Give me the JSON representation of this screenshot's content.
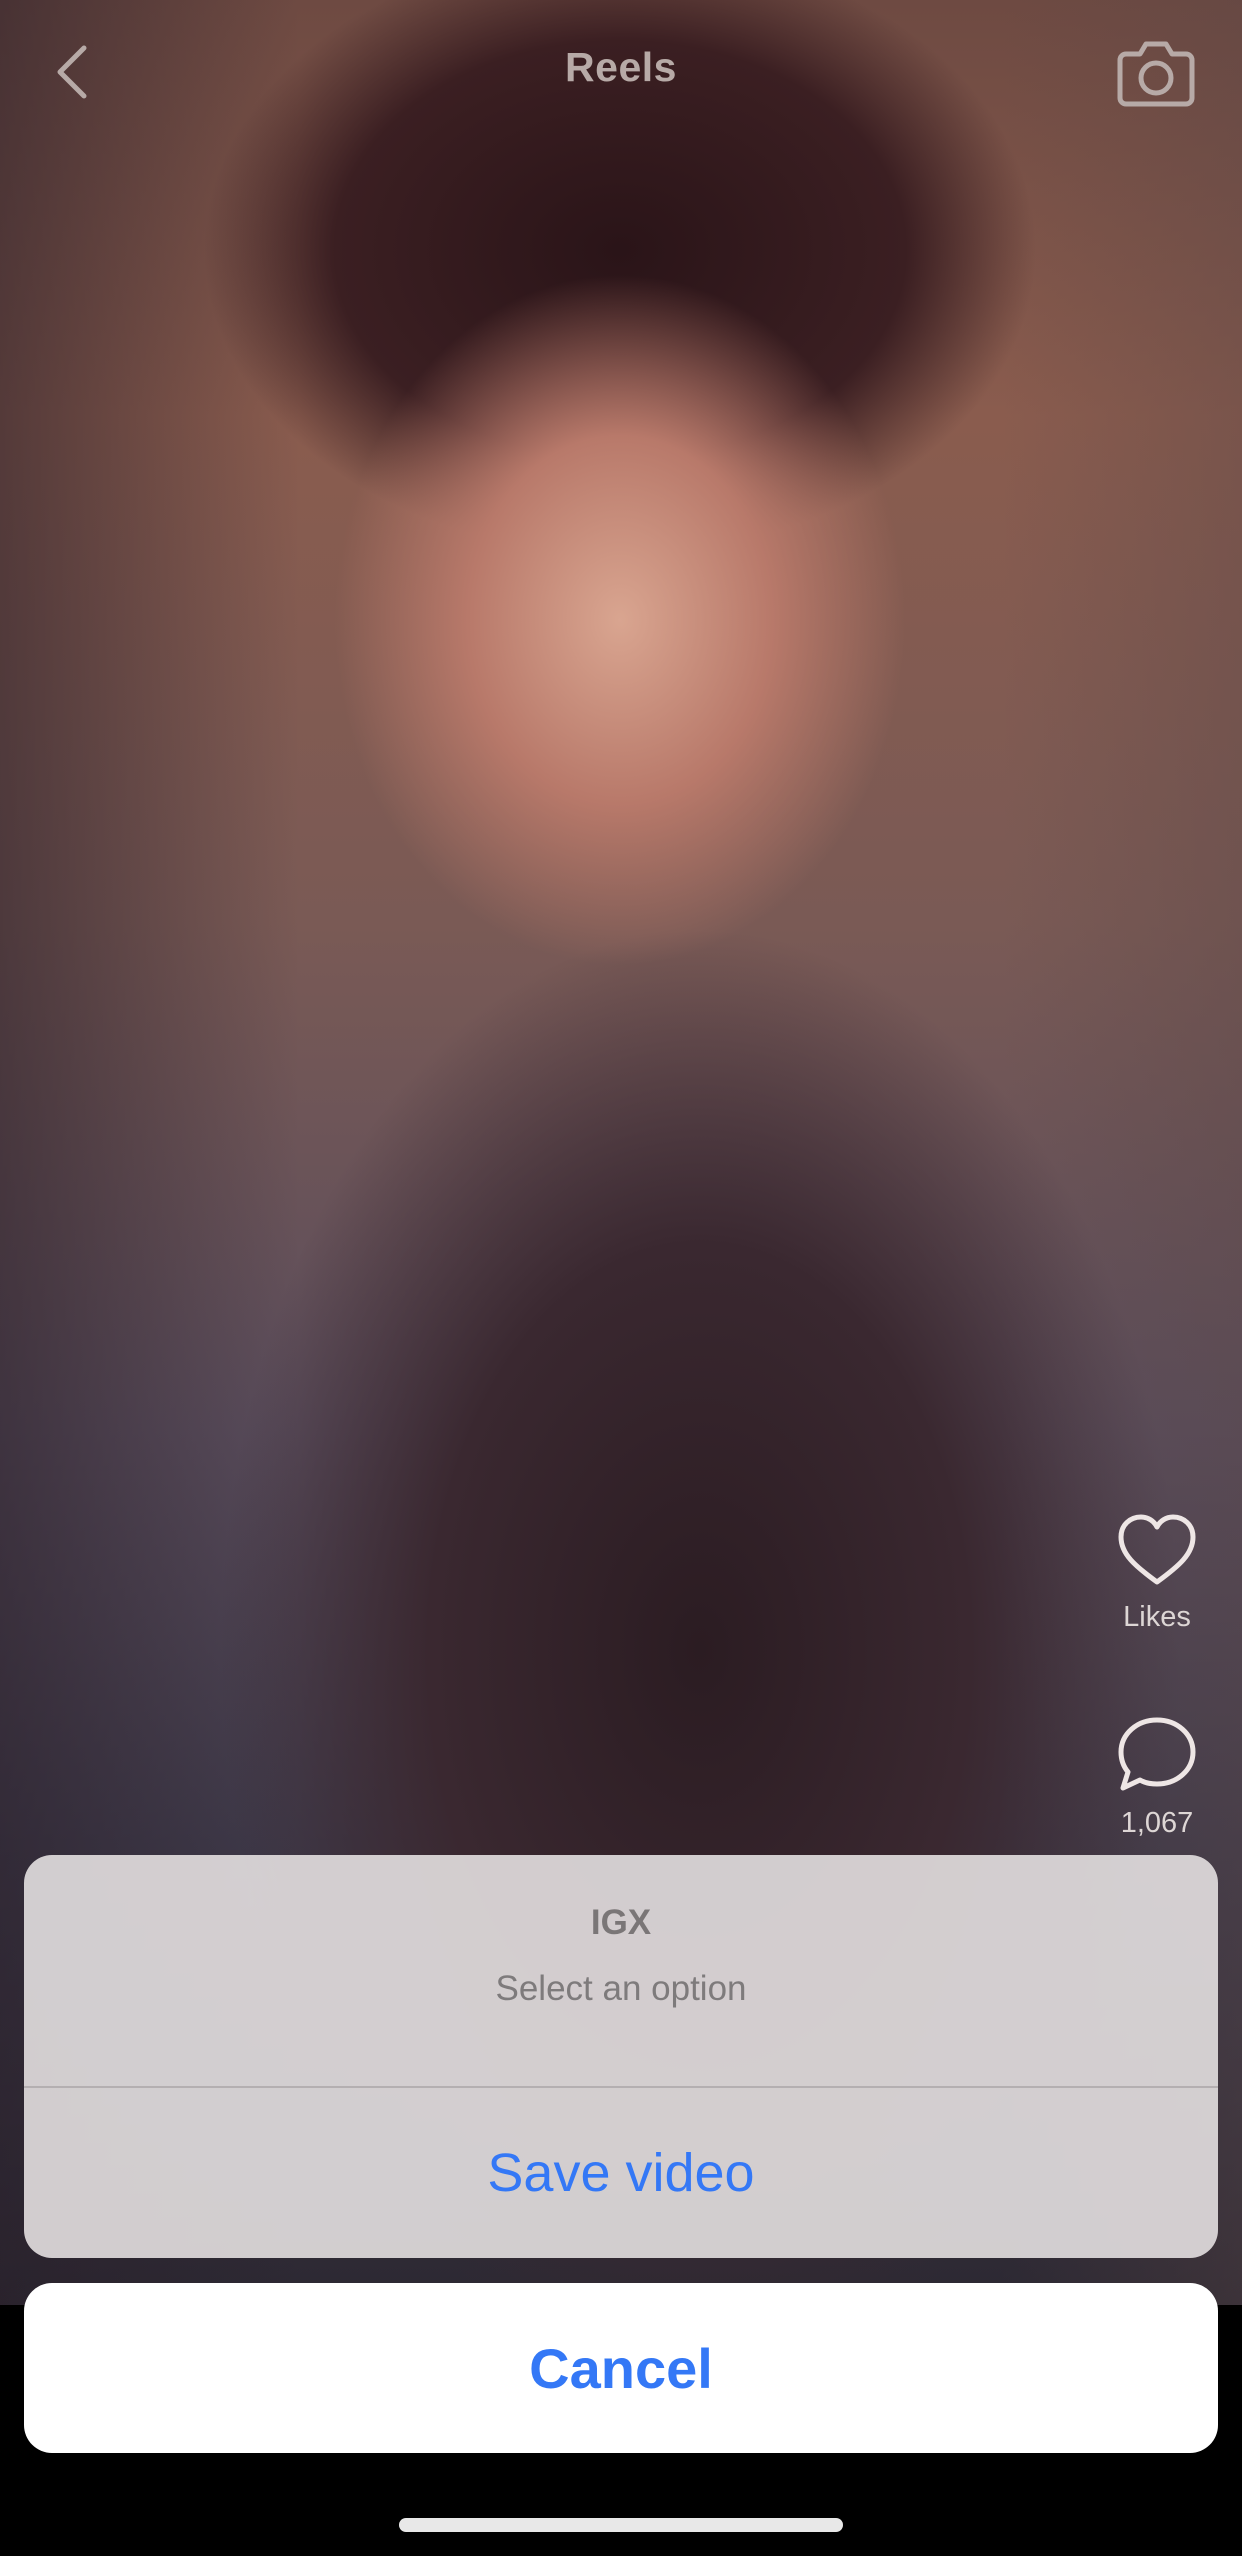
{
  "header": {
    "title": "Reels"
  },
  "actions": {
    "likes_label": "Likes",
    "comments_count": "1,067"
  },
  "action_sheet": {
    "title": "IGX",
    "subtitle": "Select an option",
    "option_save": "Save video",
    "cancel_label": "Cancel"
  },
  "colors": {
    "accent": "#3478f6",
    "sheet_background": "#dfdadb",
    "cancel_background": "#ffffff"
  },
  "icons": {
    "back": "chevron-left-icon",
    "camera": "camera-icon",
    "like": "heart-icon",
    "comment": "comment-bubble-icon"
  }
}
